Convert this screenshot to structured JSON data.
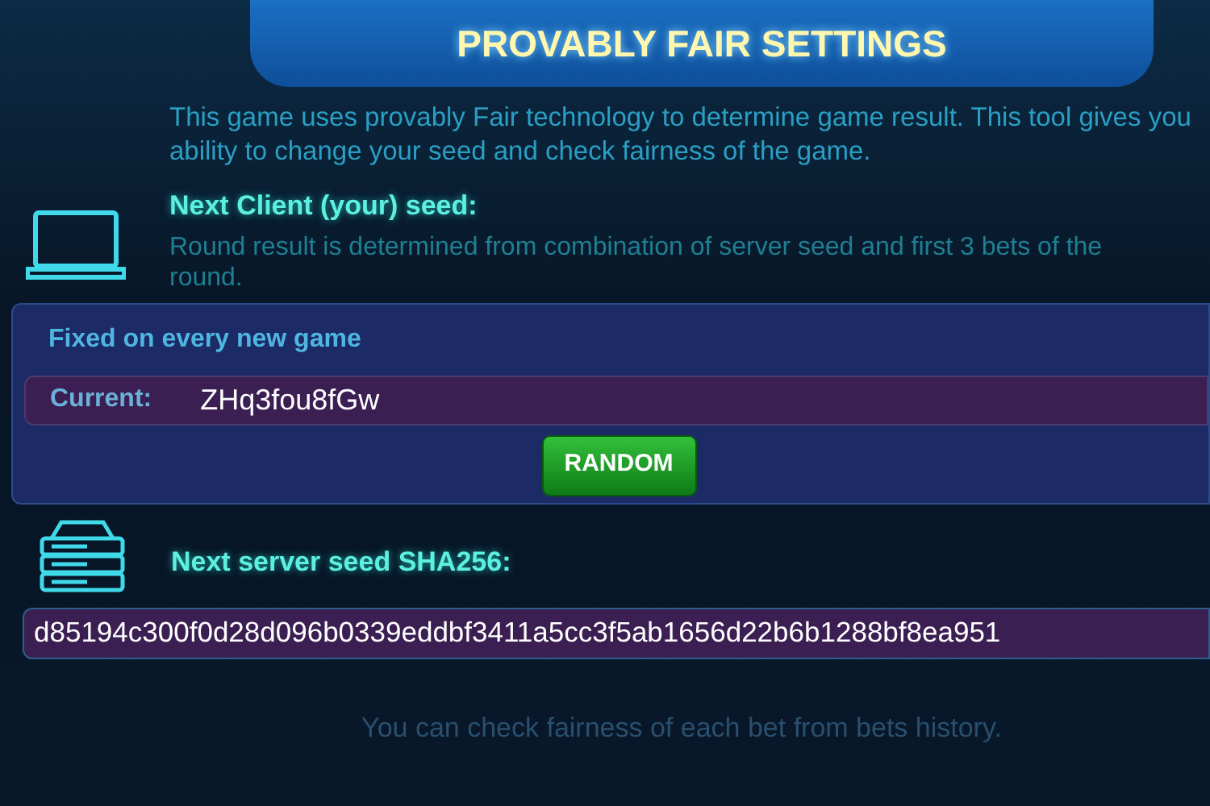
{
  "header": {
    "title": "PROVABLY FAIR SETTINGS"
  },
  "intro": "This game uses provably Fair technology to determine game result. This tool gives you ability to change your seed and check fairness of the game.",
  "client_seed": {
    "heading": "Next Client (your) seed:",
    "description": "Round result is determined from combination of server seed and first 3 bets of the round.",
    "panel": {
      "title": "Fixed on every new game",
      "label": "Current:",
      "value": "ZHq3fou8fGw",
      "button": "RANDOM"
    }
  },
  "server_seed": {
    "heading": "Next server seed SHA256:",
    "value": "d85194c300f0d28d096b0339eddbf3411a5cc3f5ab1656d22b6b1288bf8ea951"
  },
  "footer": "You can check fairness of each bet from bets history."
}
